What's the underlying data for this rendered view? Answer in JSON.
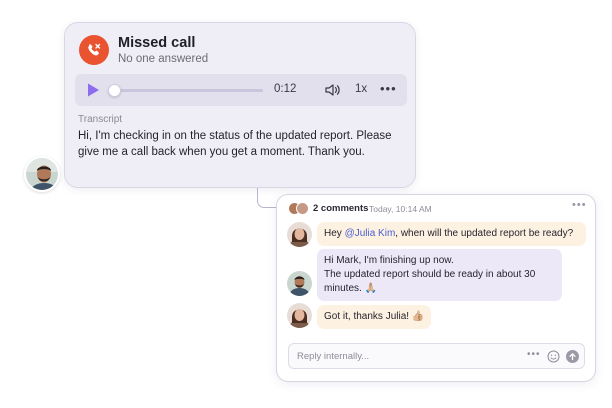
{
  "call": {
    "title": "Missed call",
    "subtitle": "No one answered",
    "icon": "missed-call-icon",
    "accent_color": "#e9532f",
    "player": {
      "time": "0:12",
      "speed": "1x",
      "more": "•••",
      "play_color": "#8d6cf0",
      "progress": 0.0
    },
    "transcript_label": "Transcript",
    "transcript_text": "Hi, I'm checking in on the status of the updated report. Please give me a call back when you get a moment. Thank you."
  },
  "comments": {
    "count_label": "2 comments",
    "timestamp": "Today, 10:14 AM",
    "more": "•••",
    "messages": [
      {
        "mention": "@Julia Kim",
        "text_before": "Hey ",
        "text_after": ", when will the updated report be ready?"
      },
      {
        "line1": "Hi Mark, I'm finishing up now.",
        "line2": "The updated report should be ready in about 30 minutes. 🙏🏼"
      },
      {
        "text": "Got it, thanks Julia! 👍🏼"
      }
    ],
    "reply_placeholder": "Reply internally...",
    "reply_more": "•••"
  }
}
